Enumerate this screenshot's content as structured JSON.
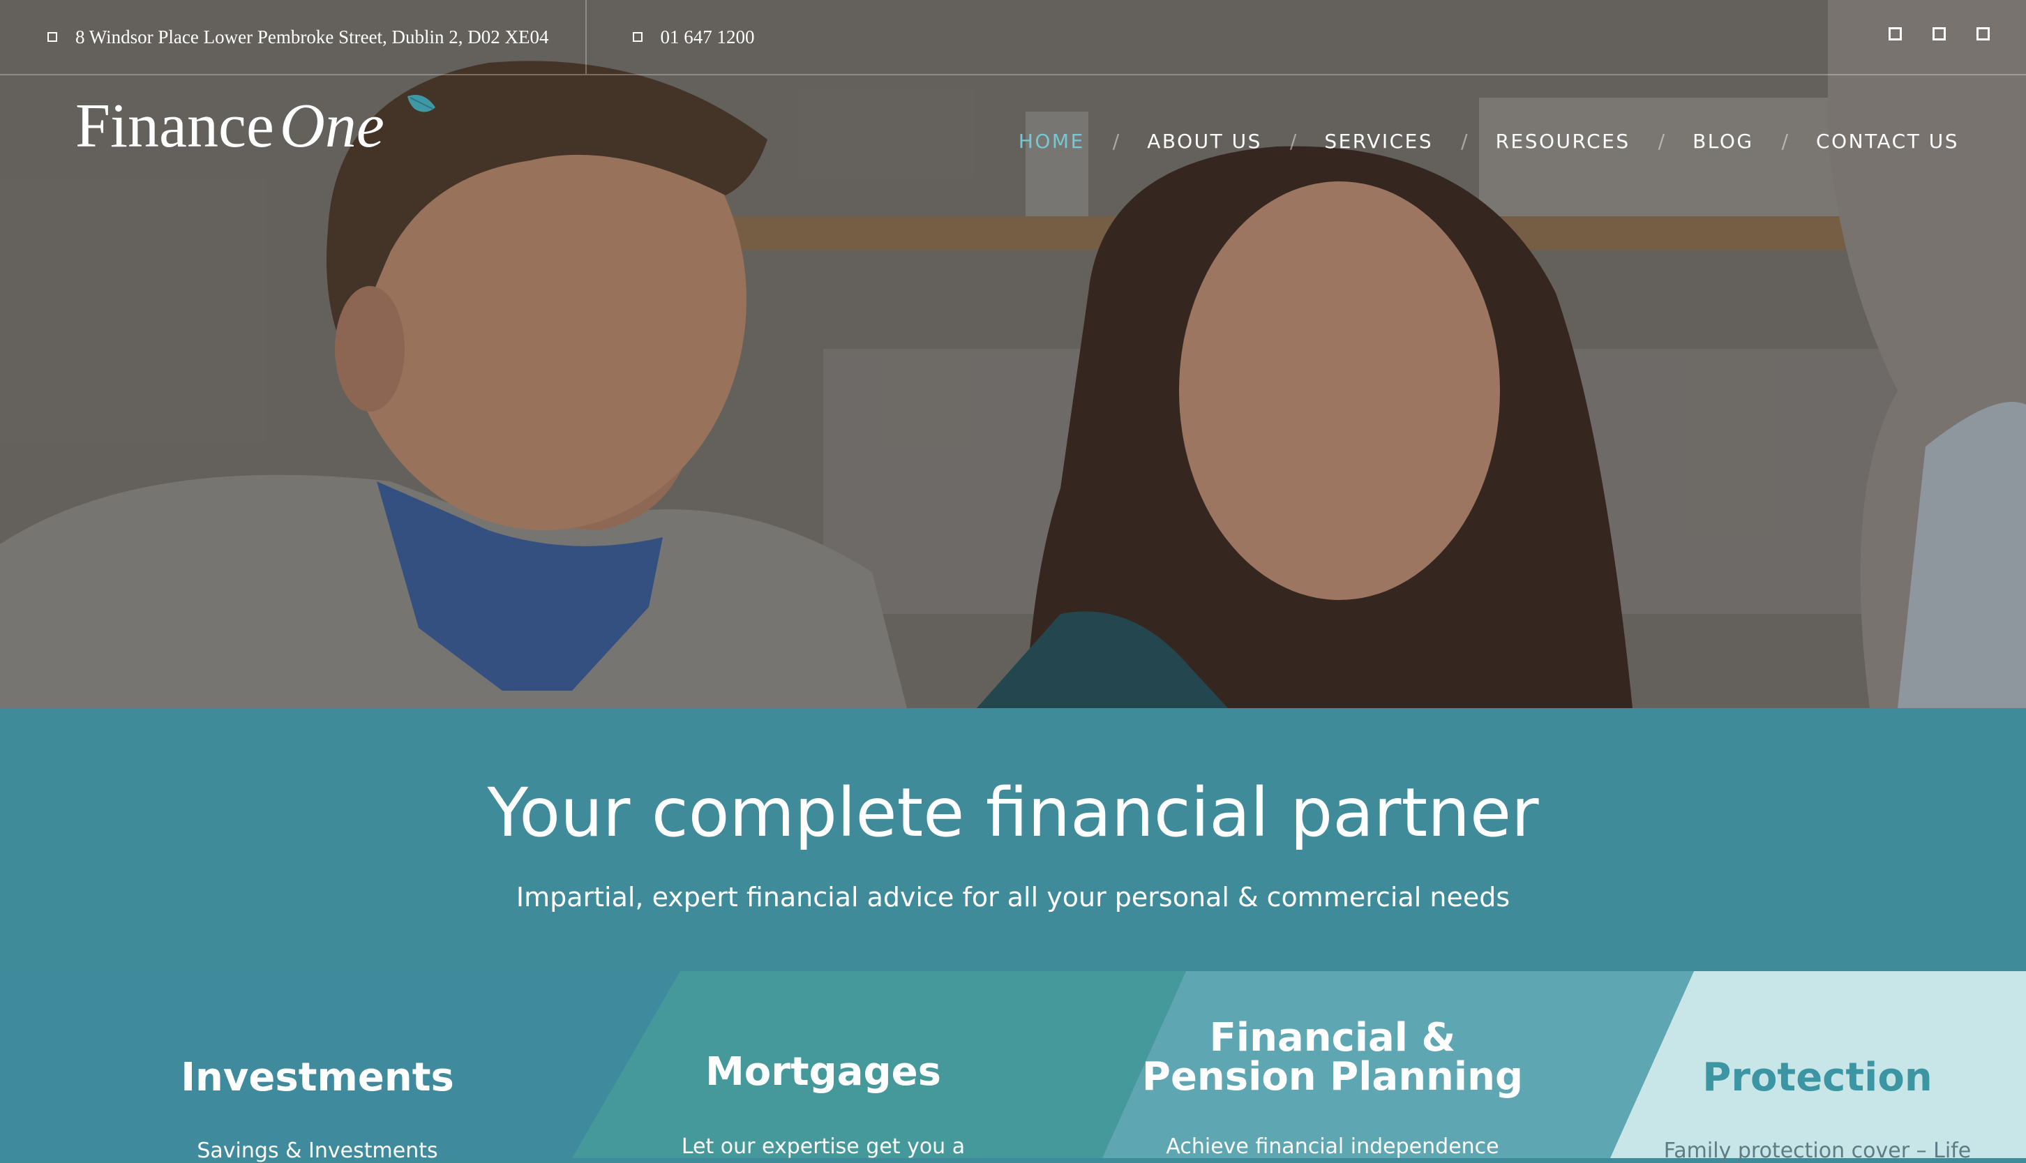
{
  "topbar": {
    "address": "8 Windsor Place Lower Pembroke Street, Dublin 2, D02 XE04",
    "phone": "01 647 1200",
    "social_icons": [
      "square-icon",
      "square-icon",
      "square-icon"
    ]
  },
  "logo": {
    "word1": "Finance",
    "word2": "One"
  },
  "nav": {
    "items": [
      {
        "label": "HOME",
        "active": true
      },
      {
        "label": "ABOUT US"
      },
      {
        "label": "SERVICES"
      },
      {
        "label": "RESOURCES"
      },
      {
        "label": "BLOG"
      },
      {
        "label": "CONTACT US"
      }
    ],
    "separator": "/"
  },
  "hero": {
    "headline": "Your complete financial partner",
    "subhead": "Impartial, expert financial advice for all your personal & commercial needs"
  },
  "services": [
    {
      "title": "Investments",
      "text": "Savings & Investments"
    },
    {
      "title": "Mortgages",
      "text": "Let our expertise get you a"
    },
    {
      "title_line1": "Financial &",
      "title_line2": "Pension Planning",
      "text": "Achieve financial independence"
    },
    {
      "title": "Protection",
      "text": "Family protection cover – Life"
    }
  ],
  "colors": {
    "accent": "#78c7d2",
    "band": "#3f8b99",
    "panel_mortgages": "#45999a",
    "panel_financial": "#5ea6b2",
    "panel_protection": "#c8e5e8",
    "protection_title": "#3b95a3"
  }
}
